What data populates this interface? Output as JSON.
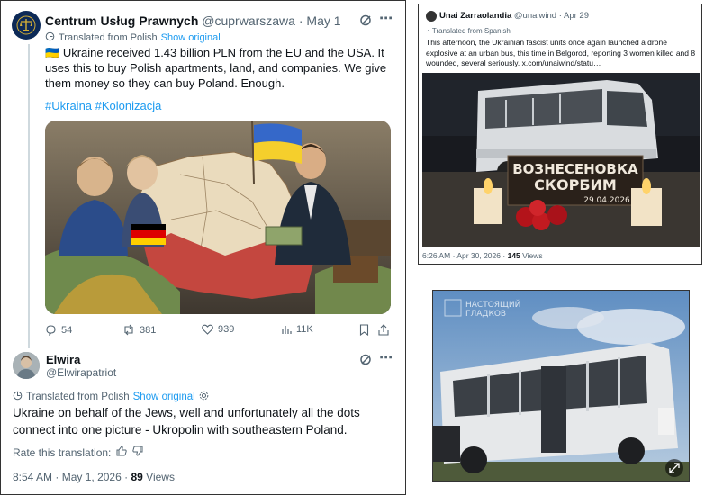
{
  "tweet1": {
    "name": "Centrum Usług Prawnych",
    "handle": "@cuprwarszawa",
    "date": "May 1",
    "translated_label": "Translated from Polish",
    "show_original": "Show original",
    "flag": "🇺🇦",
    "body": "Ukraine received 1.43 billion PLN from the EU and the USA. It uses this to buy Polish apartments, land, and companies. We give them money so they can buy Poland. Enough.",
    "hashtags": "#Ukraina #Kolonizacja",
    "replies": "54",
    "reposts": "381",
    "likes": "939",
    "views": "11K"
  },
  "tweet2": {
    "name": "Elwira",
    "handle": "@Elwirapatriot",
    "translated_label": "Translated from Polish",
    "show_original": "Show original",
    "body": "Ukraine on behalf of the Jews, well and unfortunately all the dots connect into one picture - Ukropolin with southeastern Poland.",
    "rate_label": "Rate this translation:",
    "time": "8:54 AM",
    "date": "May 1, 2026",
    "views_count": "89",
    "views_label": "Views"
  },
  "tweet3": {
    "name": "Unai Zarraolandia",
    "handle": "@unaiwind",
    "date": "Apr 29",
    "translated_label": "Translated from Spanish",
    "body": "This afternoon, the Ukrainian fascist units once again launched a drone explosive at an urban bus, this time in Belgorod, reporting 3 women killed and 8 wounded, several seriously. x.com/unaiwind/statu…",
    "sign_line1": "ВОЗНЕСЕНОВКА",
    "sign_line2": "СКОРБИМ",
    "sign_date": "29.04.2026",
    "time": "6:26 AM",
    "date_full": "Apr 30, 2026",
    "views_count": "145",
    "views_label": "Views"
  },
  "video": {
    "watermark_line1": "НАСТОЯЩИЙ",
    "watermark_line2": "ГЛАДКОВ"
  },
  "colors": {
    "accent": "#1d9bf0",
    "muted": "#536471",
    "text": "#0f1419"
  }
}
